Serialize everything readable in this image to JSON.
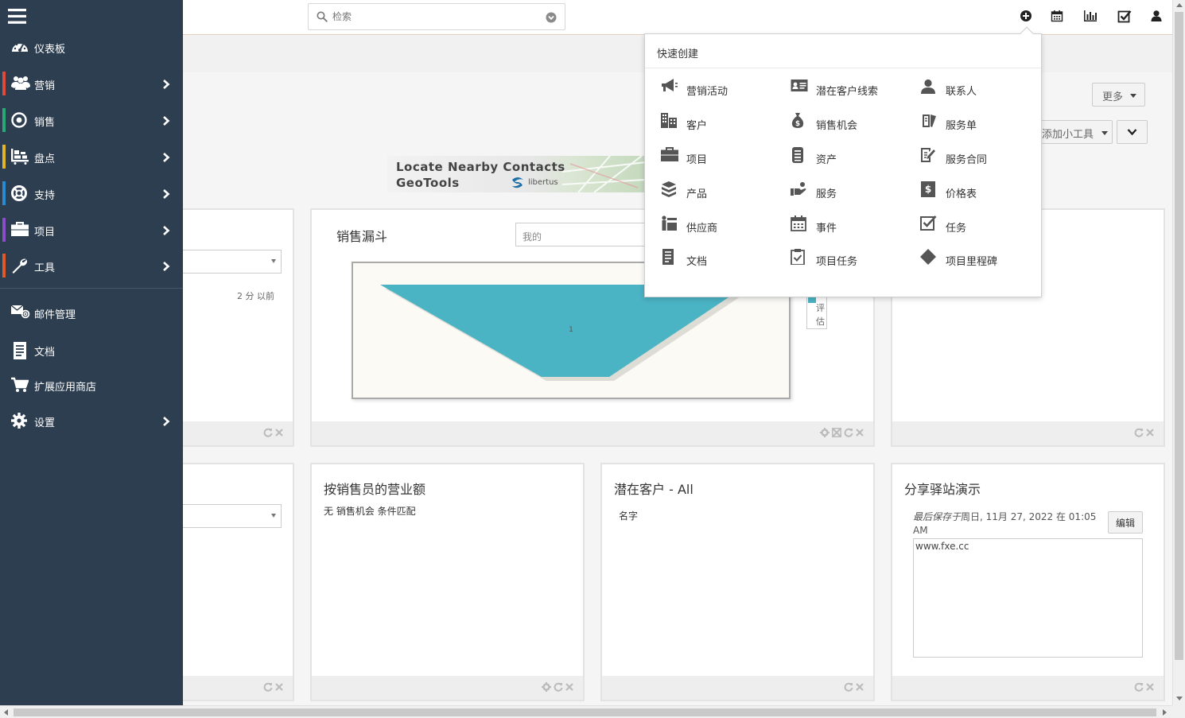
{
  "search": {
    "placeholder": "检索"
  },
  "sidebar": {
    "items": [
      {
        "label": "仪表板",
        "color": "#2d3e50"
      },
      {
        "label": "营销",
        "color": "#e04a3a"
      },
      {
        "label": "销售",
        "color": "#2aa876"
      },
      {
        "label": "盘点",
        "color": "#e0b52a"
      },
      {
        "label": "支持",
        "color": "#2a8bd1"
      },
      {
        "label": "项目",
        "color": "#8a4fc8"
      },
      {
        "label": "工具",
        "color": "#e05a2a"
      },
      {
        "label": "邮件管理"
      },
      {
        "label": "文档"
      },
      {
        "label": "扩展应用商店"
      },
      {
        "label": "设置"
      }
    ]
  },
  "header_icons": [
    "plus-circle-icon",
    "calendar-icon",
    "bar-chart-icon",
    "check-square-icon",
    "user-icon"
  ],
  "toolbar": {
    "more_label": "更多",
    "add_widget_label": "添加小工具"
  },
  "banner": {
    "line1": "Locate Nearby Contacts",
    "line2": "GeoTools",
    "brand": "libertus"
  },
  "dashlets": {
    "left_top": {
      "time": "2 分 以前"
    },
    "funnel": {
      "title": "销售漏斗",
      "filter_value": "我的",
      "legend_label": "评估",
      "chart_data": {
        "type": "funnel",
        "categories": [
          "评估"
        ],
        "values": [
          1
        ],
        "data_labels": [
          "1"
        ],
        "colors": [
          "#4ab3c4"
        ]
      }
    },
    "revenue": {
      "title": "按销售员的营业额",
      "empty_text": "无 销售机会 条件匹配"
    },
    "leads": {
      "title": "潜在客户 - All",
      "column": "名字"
    },
    "share": {
      "title": "分享驿站演示",
      "saved_prefix": "最后保存于",
      "saved_time": "周日, 11月 27, 2022 在 01:05 AM",
      "edit_label": "编辑",
      "content": "www.fxe.cc"
    }
  },
  "quick_create": {
    "title": "快速创建",
    "items": [
      {
        "label": "营销活动",
        "icon": "megaphone-icon"
      },
      {
        "label": "潜在客户线索",
        "icon": "id-card-icon"
      },
      {
        "label": "联系人",
        "icon": "contact-user-icon"
      },
      {
        "label": "客户",
        "icon": "building-icon"
      },
      {
        "label": "销售机会",
        "icon": "money-bag-icon"
      },
      {
        "label": "服务单",
        "icon": "ticket-icon"
      },
      {
        "label": "项目",
        "icon": "briefcase-icon"
      },
      {
        "label": "资产",
        "icon": "asset-icon"
      },
      {
        "label": "服务合同",
        "icon": "contract-icon"
      },
      {
        "label": "产品",
        "icon": "box-icon"
      },
      {
        "label": "服务",
        "icon": "service-hand-icon"
      },
      {
        "label": "价格表",
        "icon": "price-book-icon"
      },
      {
        "label": "供应商",
        "icon": "vendor-icon"
      },
      {
        "label": "事件",
        "icon": "event-calendar-icon"
      },
      {
        "label": "任务",
        "icon": "task-check-icon"
      },
      {
        "label": "文档",
        "icon": "document-icon"
      },
      {
        "label": "项目任务",
        "icon": "project-task-icon"
      },
      {
        "label": "项目里程碑",
        "icon": "milestone-diamond-icon"
      }
    ]
  }
}
